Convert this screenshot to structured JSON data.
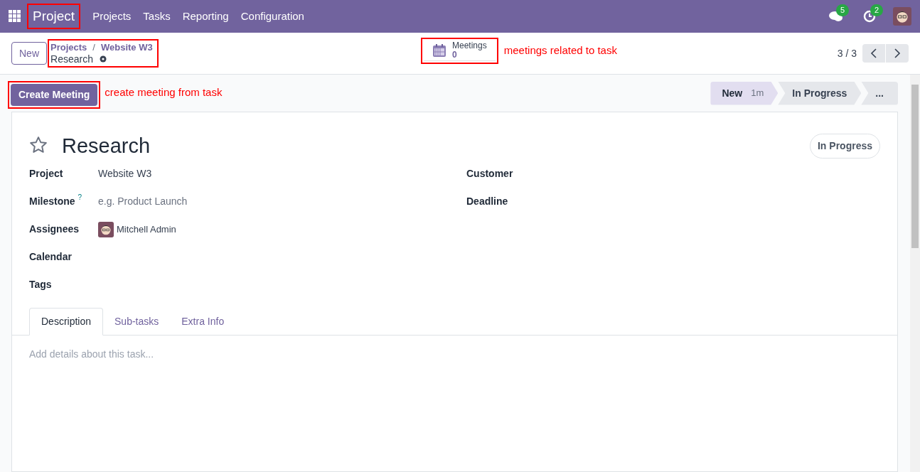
{
  "navbar": {
    "app_name": "Project",
    "app_annotated": true,
    "menu": [
      "Projects",
      "Tasks",
      "Reporting",
      "Configuration"
    ],
    "messages_badge": "5",
    "activities_badge": "2"
  },
  "control_panel": {
    "new_button": "New",
    "breadcrumbs": [
      "Projects",
      "Website W3"
    ],
    "breadcrumb_separator": "/",
    "record_name": "Research",
    "breadcrumbs_annotated": true,
    "smart_button": {
      "label": "Meetings",
      "value": "0",
      "annotated": true
    },
    "smart_button_note": "meetings related to task",
    "pager": "3 / 3"
  },
  "action_bar": {
    "button": "Create Meeting",
    "annotated": true,
    "note": "create meeting from task"
  },
  "stages": [
    {
      "label": "New",
      "duration": "1m",
      "selected": true
    },
    {
      "label": "In Progress",
      "selected": false
    },
    {
      "label": "...",
      "selected": false
    }
  ],
  "form": {
    "title": "Research",
    "starred": false,
    "state_badge": "In Progress",
    "left_fields": [
      {
        "label": "Project",
        "value": "Website W3"
      },
      {
        "label": "Milestone",
        "help": "?",
        "placeholder": "e.g. Product Launch"
      },
      {
        "label": "Assignees",
        "value": "Mitchell Admin",
        "kind": "avatar"
      },
      {
        "label": "Calendar"
      },
      {
        "label": "Tags"
      }
    ],
    "right_fields": [
      {
        "label": "Customer"
      },
      {
        "label": "Deadline"
      }
    ],
    "tabs": [
      {
        "label": "Description",
        "selected": true
      },
      {
        "label": "Sub-tasks",
        "selected": false
      },
      {
        "label": "Extra Info",
        "selected": false
      }
    ],
    "description_placeholder": "Add details about this task..."
  }
}
